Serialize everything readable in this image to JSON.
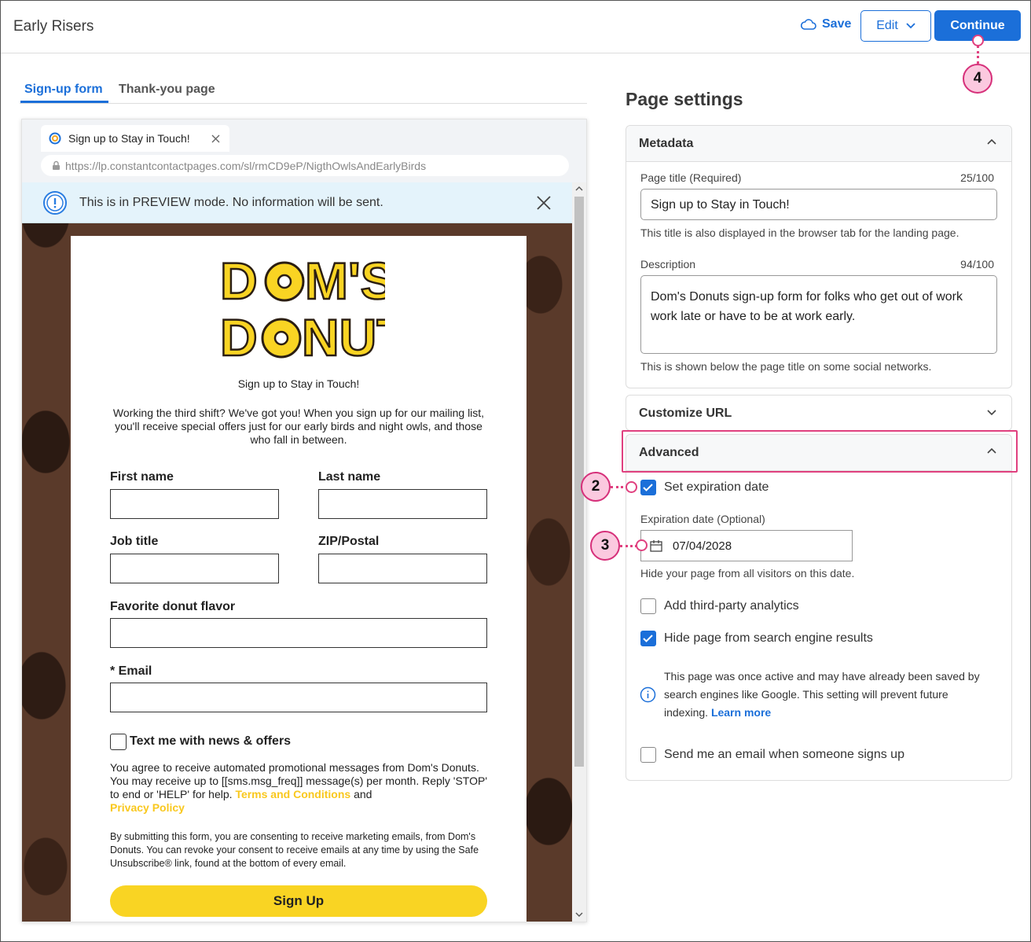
{
  "header": {
    "title": "Early Risers",
    "save_label": "Save",
    "edit_label": "Edit",
    "continue_label": "Continue"
  },
  "tabs": [
    {
      "label": "Sign-up form",
      "active": true
    },
    {
      "label": "Thank-you page",
      "active": false
    }
  ],
  "browser": {
    "tab_title": "Sign up to Stay in Touch!",
    "url": "https://lp.constantcontactpages.com/sl/rmCD9eP/NigthOwlsAndEarlyBirds"
  },
  "preview": {
    "banner_text": "This is in PREVIEW mode. No information will be sent."
  },
  "form": {
    "logo_line1": "DOM'S",
    "logo_line2": "DONUTS",
    "heading": "Sign up to Stay in Touch!",
    "intro": "Working the third shift? We've got you! When you sign up for our mailing list, you'll receive special offers just for our early birds and night owls, and those who fall in between.",
    "fields": {
      "first_name": "First name",
      "last_name": "Last name",
      "job_title": "Job title",
      "zip": "ZIP/Postal",
      "flavor": "Favorite donut flavor",
      "email": "* Email"
    },
    "sms_label": "Text me with news & offers",
    "sms_terms": "You agree to receive automated promotional messages from Dom's Donuts. You may receive up to [[sms.msg_freq]] message(s) per month. Reply 'STOP' to end or 'HELP' for help.",
    "terms_link": "Terms and Conditions",
    "and_text": "and",
    "privacy_link": "Privacy Policy",
    "consent": "By submitting this form, you are consenting to receive marketing emails, from Dom's Donuts. You can revoke your consent to receive emails at any time by using the Safe Unsubscribe® link, found at the bottom of every email.",
    "submit_label": "Sign Up"
  },
  "settings": {
    "title": "Page settings",
    "metadata": {
      "header": "Metadata",
      "page_title_label": "Page title",
      "page_title_qualifier": "(Required)",
      "page_title_count": "25/100",
      "page_title_value": "Sign up to Stay in Touch!",
      "page_title_hint": "This title is also displayed in the browser tab for the landing page.",
      "description_label": "Description",
      "description_count": "94/100",
      "description_value": "Dom's Donuts sign-up form for folks who get out of work work late or have to be at work early.",
      "description_hint": "This is shown below the page title on some social networks."
    },
    "customize_url": {
      "header": "Customize URL"
    },
    "advanced": {
      "header": "Advanced",
      "set_expiration_label": "Set expiration date",
      "set_expiration_checked": true,
      "expiration_label": "Expiration date",
      "expiration_qualifier": "(Optional)",
      "expiration_value": "07/04/2028",
      "expiration_hint": "Hide your page from all visitors on this date.",
      "analytics_label": "Add third-party analytics",
      "analytics_checked": false,
      "hide_search_label": "Hide page from search engine results",
      "hide_search_checked": true,
      "info_text": "This page was once active and may have already been saved by search engines like Google. This setting will prevent future indexing.",
      "learn_more": "Learn more",
      "email_notify_label": "Send me an email when someone signs up",
      "email_notify_checked": false
    }
  },
  "callouts": [
    "2",
    "3",
    "4"
  ],
  "colors": {
    "accent": "#1b6fd9",
    "callout": "#e0407f",
    "brand_yellow": "#f9d423"
  }
}
